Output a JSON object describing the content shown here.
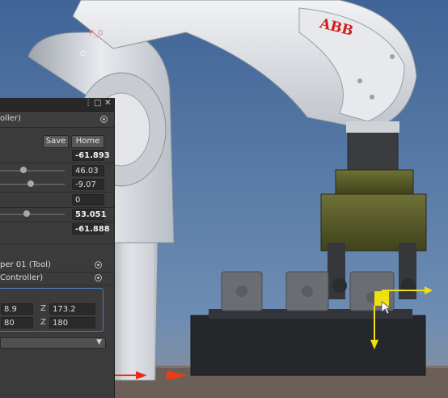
{
  "scene": {
    "robot_brand": "ABB",
    "gizmo_label": "P_0",
    "colors": {
      "sky": "#4d6f9a",
      "floor": "#6a5e57",
      "gripper": "#585c2a",
      "accent_gizmo": "#f0e010"
    }
  },
  "inspector": {
    "title_suffix": "oller)",
    "save_label": "Save",
    "home_label": "Home",
    "joints": [
      {
        "value": "-61.893",
        "slider": null,
        "bold": true
      },
      {
        "value": "46.03",
        "slider": 0.55
      },
      {
        "value": "-9.07",
        "slider": 0.6
      },
      {
        "value": "0",
        "slider": null
      },
      {
        "value": "53.051",
        "slider": 0.55,
        "bold": true
      },
      {
        "value": "-61.888",
        "slider": null,
        "bold": true
      }
    ],
    "tool_label": "per 01 (Tool)",
    "controller_label": "Controller)",
    "position": {
      "x_value": "8.9",
      "z_label": "Z",
      "z_value": "173.2"
    },
    "rotation": {
      "x_value": "80",
      "z_label": "Z",
      "z_value": "180"
    }
  }
}
